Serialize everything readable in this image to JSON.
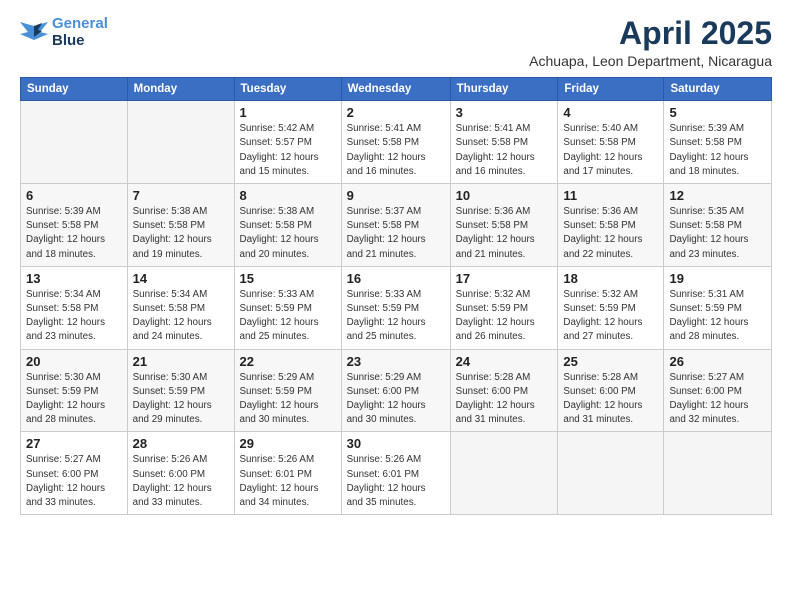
{
  "logo": {
    "line1": "General",
    "line2": "Blue"
  },
  "title": "April 2025",
  "location": "Achuapa, Leon Department, Nicaragua",
  "days_header": [
    "Sunday",
    "Monday",
    "Tuesday",
    "Wednesday",
    "Thursday",
    "Friday",
    "Saturday"
  ],
  "weeks": [
    [
      {
        "day": "",
        "info": ""
      },
      {
        "day": "",
        "info": ""
      },
      {
        "day": "1",
        "info": "Sunrise: 5:42 AM\nSunset: 5:57 PM\nDaylight: 12 hours\nand 15 minutes."
      },
      {
        "day": "2",
        "info": "Sunrise: 5:41 AM\nSunset: 5:58 PM\nDaylight: 12 hours\nand 16 minutes."
      },
      {
        "day": "3",
        "info": "Sunrise: 5:41 AM\nSunset: 5:58 PM\nDaylight: 12 hours\nand 16 minutes."
      },
      {
        "day": "4",
        "info": "Sunrise: 5:40 AM\nSunset: 5:58 PM\nDaylight: 12 hours\nand 17 minutes."
      },
      {
        "day": "5",
        "info": "Sunrise: 5:39 AM\nSunset: 5:58 PM\nDaylight: 12 hours\nand 18 minutes."
      }
    ],
    [
      {
        "day": "6",
        "info": "Sunrise: 5:39 AM\nSunset: 5:58 PM\nDaylight: 12 hours\nand 18 minutes."
      },
      {
        "day": "7",
        "info": "Sunrise: 5:38 AM\nSunset: 5:58 PM\nDaylight: 12 hours\nand 19 minutes."
      },
      {
        "day": "8",
        "info": "Sunrise: 5:38 AM\nSunset: 5:58 PM\nDaylight: 12 hours\nand 20 minutes."
      },
      {
        "day": "9",
        "info": "Sunrise: 5:37 AM\nSunset: 5:58 PM\nDaylight: 12 hours\nand 21 minutes."
      },
      {
        "day": "10",
        "info": "Sunrise: 5:36 AM\nSunset: 5:58 PM\nDaylight: 12 hours\nand 21 minutes."
      },
      {
        "day": "11",
        "info": "Sunrise: 5:36 AM\nSunset: 5:58 PM\nDaylight: 12 hours\nand 22 minutes."
      },
      {
        "day": "12",
        "info": "Sunrise: 5:35 AM\nSunset: 5:58 PM\nDaylight: 12 hours\nand 23 minutes."
      }
    ],
    [
      {
        "day": "13",
        "info": "Sunrise: 5:34 AM\nSunset: 5:58 PM\nDaylight: 12 hours\nand 23 minutes."
      },
      {
        "day": "14",
        "info": "Sunrise: 5:34 AM\nSunset: 5:58 PM\nDaylight: 12 hours\nand 24 minutes."
      },
      {
        "day": "15",
        "info": "Sunrise: 5:33 AM\nSunset: 5:59 PM\nDaylight: 12 hours\nand 25 minutes."
      },
      {
        "day": "16",
        "info": "Sunrise: 5:33 AM\nSunset: 5:59 PM\nDaylight: 12 hours\nand 25 minutes."
      },
      {
        "day": "17",
        "info": "Sunrise: 5:32 AM\nSunset: 5:59 PM\nDaylight: 12 hours\nand 26 minutes."
      },
      {
        "day": "18",
        "info": "Sunrise: 5:32 AM\nSunset: 5:59 PM\nDaylight: 12 hours\nand 27 minutes."
      },
      {
        "day": "19",
        "info": "Sunrise: 5:31 AM\nSunset: 5:59 PM\nDaylight: 12 hours\nand 28 minutes."
      }
    ],
    [
      {
        "day": "20",
        "info": "Sunrise: 5:30 AM\nSunset: 5:59 PM\nDaylight: 12 hours\nand 28 minutes."
      },
      {
        "day": "21",
        "info": "Sunrise: 5:30 AM\nSunset: 5:59 PM\nDaylight: 12 hours\nand 29 minutes."
      },
      {
        "day": "22",
        "info": "Sunrise: 5:29 AM\nSunset: 5:59 PM\nDaylight: 12 hours\nand 30 minutes."
      },
      {
        "day": "23",
        "info": "Sunrise: 5:29 AM\nSunset: 6:00 PM\nDaylight: 12 hours\nand 30 minutes."
      },
      {
        "day": "24",
        "info": "Sunrise: 5:28 AM\nSunset: 6:00 PM\nDaylight: 12 hours\nand 31 minutes."
      },
      {
        "day": "25",
        "info": "Sunrise: 5:28 AM\nSunset: 6:00 PM\nDaylight: 12 hours\nand 31 minutes."
      },
      {
        "day": "26",
        "info": "Sunrise: 5:27 AM\nSunset: 6:00 PM\nDaylight: 12 hours\nand 32 minutes."
      }
    ],
    [
      {
        "day": "27",
        "info": "Sunrise: 5:27 AM\nSunset: 6:00 PM\nDaylight: 12 hours\nand 33 minutes."
      },
      {
        "day": "28",
        "info": "Sunrise: 5:26 AM\nSunset: 6:00 PM\nDaylight: 12 hours\nand 33 minutes."
      },
      {
        "day": "29",
        "info": "Sunrise: 5:26 AM\nSunset: 6:01 PM\nDaylight: 12 hours\nand 34 minutes."
      },
      {
        "day": "30",
        "info": "Sunrise: 5:26 AM\nSunset: 6:01 PM\nDaylight: 12 hours\nand 35 minutes."
      },
      {
        "day": "",
        "info": ""
      },
      {
        "day": "",
        "info": ""
      },
      {
        "day": "",
        "info": ""
      }
    ]
  ]
}
